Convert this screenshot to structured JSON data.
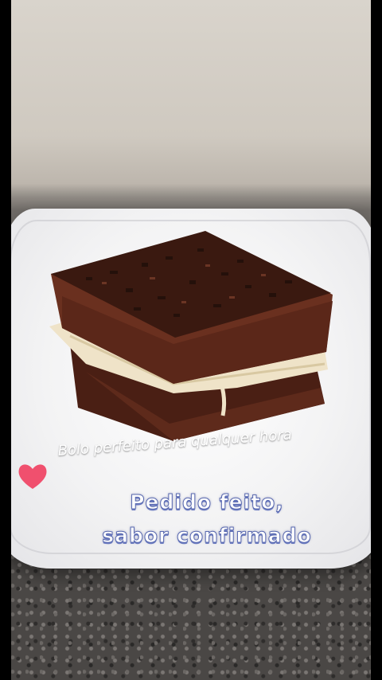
{
  "image": {
    "subject": "chocolate-cake-icon",
    "colors": {
      "cake": "#5a2a1c",
      "filling": "#efe3c8",
      "plate": "#f5f5f7",
      "heart": "#f0506e",
      "headline_outline": "#5a6ab0"
    }
  },
  "overlay": {
    "caption": "Bolo perfeito para qualquer hora",
    "headline_line1": "Pedido feito,",
    "headline_line2": "sabor confirmado"
  }
}
